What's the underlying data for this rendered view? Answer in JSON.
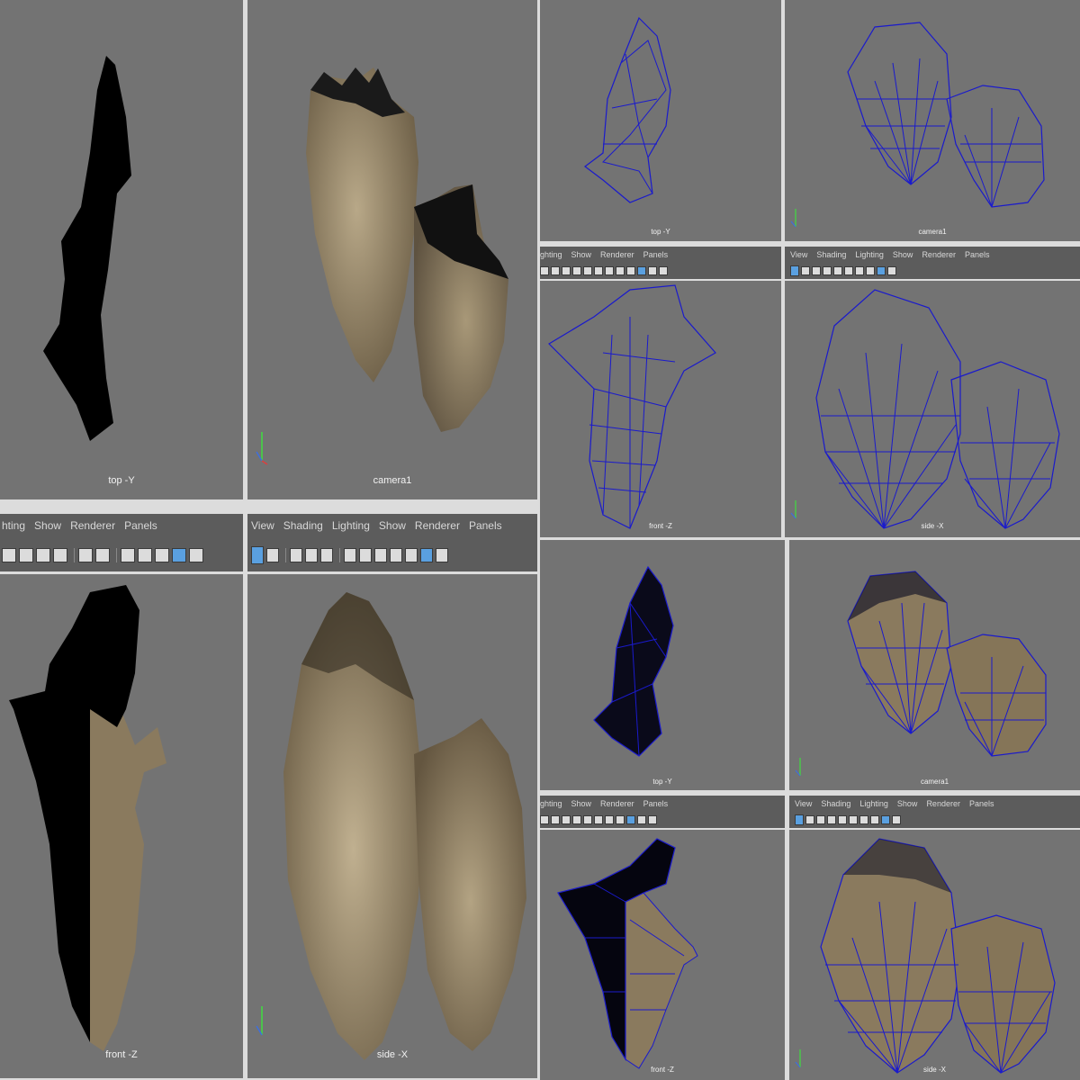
{
  "window": {
    "menu_left_partial": [
      "hting",
      "Show",
      "Renderer",
      "Panels"
    ],
    "menu_left_partial2": [
      "ghting",
      "Show",
      "Renderer",
      "Panels"
    ],
    "menu_full": [
      "View",
      "Shading",
      "Lighting",
      "Show",
      "Renderer",
      "Panels"
    ]
  },
  "panels": {
    "q1_top": "top -Y",
    "q1_camera": "camera1",
    "q1_front": "front -Z",
    "q1_side": "side -X",
    "q2_top": "top -Y",
    "q2_camera": "camera1",
    "q2_front": "front -Z",
    "q2_side": "side -X",
    "q3_top": "top -Y",
    "q3_camera": "camera1",
    "q3_front": "front -Z",
    "q3_side": "side -X"
  },
  "axis_labels": {
    "y": "Y",
    "z": "Z"
  },
  "colors": {
    "viewport_bg": "#737373",
    "wire": "#1a1acc",
    "shade": "#8a7a5e",
    "accent": "#5aa0e0"
  }
}
